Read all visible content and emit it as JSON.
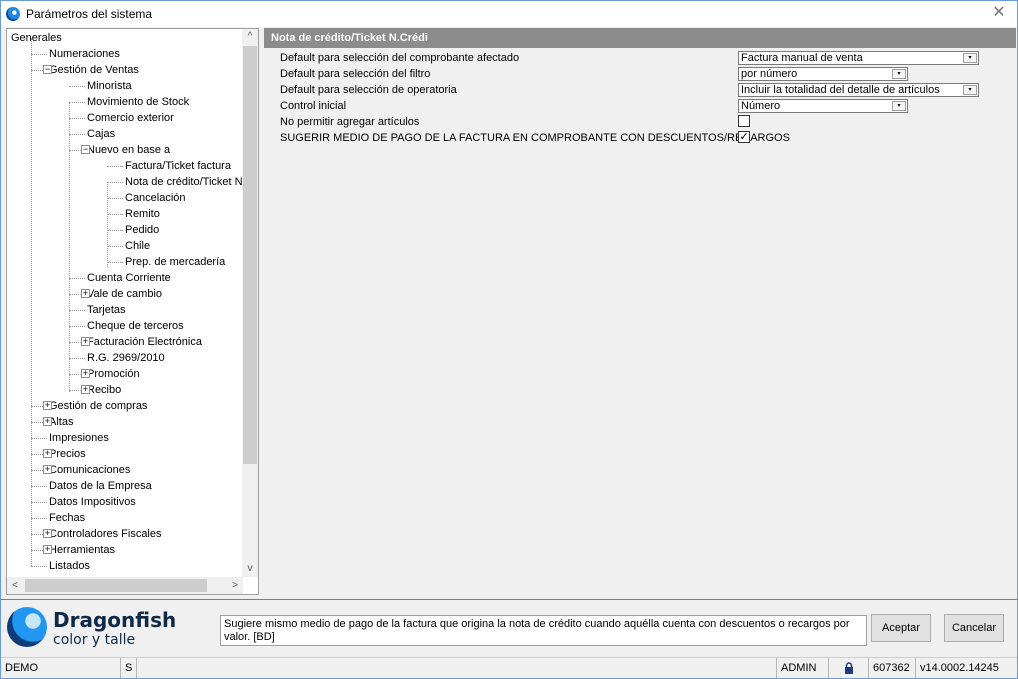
{
  "window": {
    "title": "Parámetros del sistema",
    "close_icon": "close-icon"
  },
  "tree": {
    "items": [
      {
        "label": "Generales",
        "level": 0,
        "expander": ""
      },
      {
        "label": "Numeraciones",
        "level": 1,
        "expander": ""
      },
      {
        "label": "Gestión de Ventas",
        "level": 1,
        "expander": "−"
      },
      {
        "label": "Minorista",
        "level": 2,
        "expander": ""
      },
      {
        "label": "Movimiento de Stock",
        "level": 2,
        "expander": ""
      },
      {
        "label": "Comercio exterior",
        "level": 2,
        "expander": ""
      },
      {
        "label": "Cajas",
        "level": 2,
        "expander": ""
      },
      {
        "label": "Nuevo en base a",
        "level": 2,
        "expander": "−"
      },
      {
        "label": "Factura/Ticket factura",
        "level": 3,
        "expander": ""
      },
      {
        "label": "Nota de crédito/Ticket N",
        "level": 3,
        "expander": ""
      },
      {
        "label": "Cancelación",
        "level": 3,
        "expander": ""
      },
      {
        "label": "Remito",
        "level": 3,
        "expander": ""
      },
      {
        "label": "Pedido",
        "level": 3,
        "expander": ""
      },
      {
        "label": "Chile",
        "level": 3,
        "expander": ""
      },
      {
        "label": "Prep. de mercadería",
        "level": 3,
        "expander": ""
      },
      {
        "label": "Cuenta Corriente",
        "level": 2,
        "expander": ""
      },
      {
        "label": "Vale de cambio",
        "level": 2,
        "expander": "+"
      },
      {
        "label": "Tarjetas",
        "level": 2,
        "expander": ""
      },
      {
        "label": "Cheque de terceros",
        "level": 2,
        "expander": ""
      },
      {
        "label": "Facturación Electrónica",
        "level": 2,
        "expander": "+"
      },
      {
        "label": "R.G. 2969/2010",
        "level": 2,
        "expander": ""
      },
      {
        "label": "Promoción",
        "level": 2,
        "expander": "+"
      },
      {
        "label": "Recibo",
        "level": 2,
        "expander": "+"
      },
      {
        "label": "Gestión de compras",
        "level": 1,
        "expander": "+"
      },
      {
        "label": "Altas",
        "level": 1,
        "expander": "+"
      },
      {
        "label": "Impresiones",
        "level": 1,
        "expander": ""
      },
      {
        "label": "Precios",
        "level": 1,
        "expander": "+"
      },
      {
        "label": "Comunicaciones",
        "level": 1,
        "expander": "+"
      },
      {
        "label": "Datos de la Empresa",
        "level": 1,
        "expander": ""
      },
      {
        "label": "Datos Impositivos",
        "level": 1,
        "expander": ""
      },
      {
        "label": "Fechas",
        "level": 1,
        "expander": ""
      },
      {
        "label": "Controladores Fiscales",
        "level": 1,
        "expander": "+"
      },
      {
        "label": "Herramientas",
        "level": 1,
        "expander": "+"
      },
      {
        "label": "Listados",
        "level": 1,
        "expander": ""
      }
    ],
    "scroll_up": "^",
    "scroll_down": "v",
    "scroll_left": "<",
    "scroll_right": ">"
  },
  "section": {
    "title": "Nota de crédito/Ticket N.Crédi"
  },
  "properties": [
    {
      "label": "Default para selección del comprobante afectado",
      "type": "combo",
      "value": "Factura manual de venta"
    },
    {
      "label": "Default para selección del filtro",
      "type": "combo",
      "value": "por número"
    },
    {
      "label": "Default para selección de operatoria",
      "type": "combo",
      "value": "Incluir la totalidad del detalle de artículos"
    },
    {
      "label": "Control inicial",
      "type": "combo",
      "value": "Número"
    },
    {
      "label": "No permitir agregar artículos",
      "type": "checkbox",
      "value": ""
    },
    {
      "label": "SUGERIR MEDIO DE PAGO DE LA FACTURA EN COMPROBANTE CON DESCUENTOS/RECARGOS",
      "type": "checkbox",
      "value": "✓"
    }
  ],
  "logo": {
    "name": "Dragonfish",
    "subtitle": "color y talle"
  },
  "help_text": "Sugiere mismo medio de pago de la factura que origina la nota de crédito cuando aquélla cuenta con descuentos o recargos por valor. [BD]",
  "buttons": {
    "accept": "Aceptar",
    "cancel": "Cancelar"
  },
  "status": {
    "env": "DEMO",
    "mode": "S",
    "user": "ADMIN",
    "lock_icon": "lock-icon",
    "number": "607362",
    "version": "v14.0002.14245"
  },
  "combo_arrow": "▾"
}
